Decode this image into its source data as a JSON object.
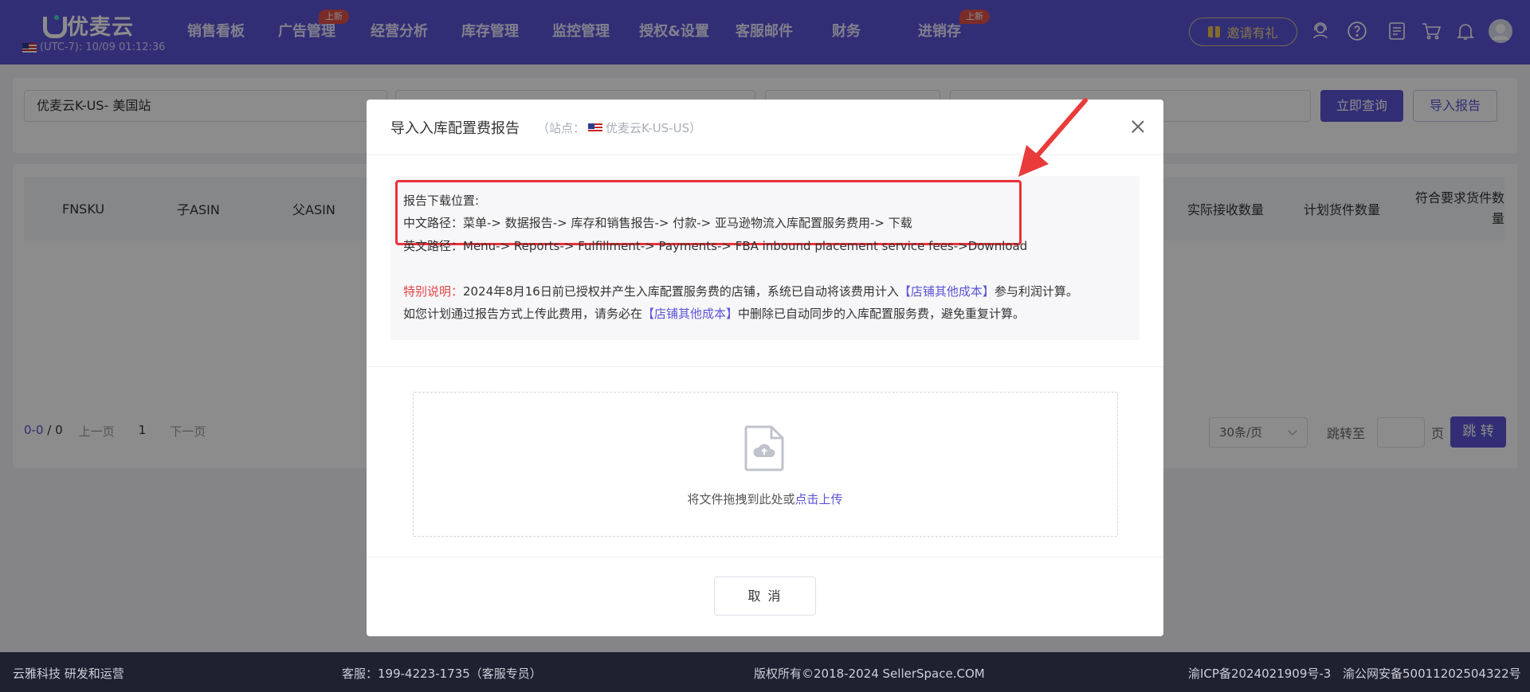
{
  "header": {
    "logo_text": "优麦云",
    "clock": "(UTC-7): 10/09 01:12:36",
    "nav": [
      {
        "label": "销售看板",
        "badge": ""
      },
      {
        "label": "广告管理",
        "badge": "上新"
      },
      {
        "label": "经营分析",
        "badge": ""
      },
      {
        "label": "库存管理",
        "badge": ""
      },
      {
        "label": "监控管理",
        "badge": ""
      },
      {
        "label": "授权&设置",
        "badge": ""
      },
      {
        "label": "客服邮件",
        "badge": ""
      },
      {
        "label": "财务",
        "badge": ""
      },
      {
        "label": "进销存",
        "badge": "上新"
      }
    ],
    "invite_label": "邀请有礼",
    "icons": [
      "user-headset-icon",
      "help-icon",
      "notes-icon",
      "cart-icon",
      "bell-icon",
      "avatar"
    ]
  },
  "filters": {
    "store": "优麦云K-US- 美国站",
    "query_button": "立即查询",
    "import_button": "导入报告"
  },
  "table": {
    "columns": [
      "FNSKU",
      "子ASIN",
      "父ASIN",
      "实际接收数量",
      "计划货件数量",
      "符合要求货件数量"
    ]
  },
  "pagination": {
    "range": "0-0",
    "total": "0",
    "prev": "上一页",
    "current": "1",
    "next": "下一页",
    "page_size": "30条/页",
    "jump_label": "跳转至",
    "jump_unit": "页",
    "jump_button": "跳 转"
  },
  "footer": {
    "company": "云雅科技 研发和运营",
    "service": "客服：199-4223-1735（客服专员）",
    "copyright": "版权所有©2018-2024 SellerSpace.COM",
    "icp": "渝ICP备2024021909号-3",
    "police": "渝公网安备50011202504322号"
  },
  "modal": {
    "title": "导入入库配置费报告",
    "site_prefix": "（站点：",
    "site_name": "优麦云K-US-US）",
    "info_heading": "报告下载位置:",
    "cn_path": "中文路径：菜单-> 数据报告-> 库存和销售报告-> 付款-> 亚马逊物流入库配置服务费用-> 下载",
    "en_path": "英文路径：Menu-> Reports-> Fulfillment-> Payments-> FBA inbound placement service fees->Download",
    "note_label": "特别说明：",
    "note_line1_a": "2024年8月16日前已授权并产生入库配置服务费的店铺，系统已自动将该费用计入",
    "note_link": "【店铺其他成本】",
    "note_line1_b": "参与利润计算。",
    "note_line2_a": "如您计划通过报告方式上传此费用，请务必在",
    "note_line2_b": "中删除已自动同步的入库配置服务费，避免重复计算。",
    "upload_text": "将文件拖拽到此处或",
    "upload_link": "点击上传",
    "cancel": "取 消"
  }
}
